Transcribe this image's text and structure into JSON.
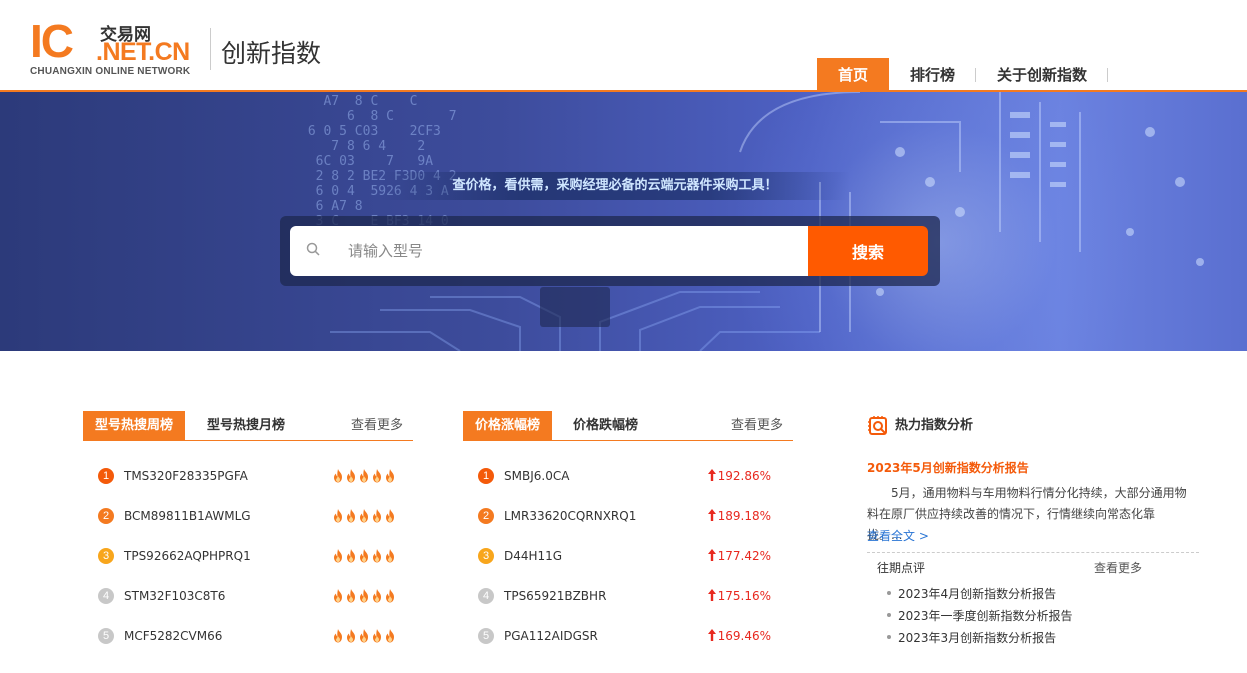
{
  "header": {
    "logo": {
      "ic": "IC",
      "brand_cn": "交易网",
      "net": ".NET.CN",
      "tagline": "CHUANGXIN ONLINE NETWORK"
    },
    "site_title": "创新指数",
    "nav": [
      {
        "label": "首页",
        "active": true
      },
      {
        "label": "排行榜",
        "active": false
      },
      {
        "label": "关于创新指数",
        "active": false
      }
    ]
  },
  "banner": {
    "slogan": "查价格，看供需，采购经理必备的云端元器件采购工具！",
    "search": {
      "placeholder": "请输入型号",
      "value": "",
      "button": "搜索"
    }
  },
  "hot_search": {
    "tab_active": "型号热搜周榜",
    "tab_inactive": "型号热搜月榜",
    "more": "查看更多",
    "items": [
      {
        "rank": "1",
        "name": "TMS320F28335PGFA",
        "flames": 5
      },
      {
        "rank": "2",
        "name": "BCM89811B1AWMLG",
        "flames": 5
      },
      {
        "rank": "3",
        "name": "TPS92662AQPHPRQ1",
        "flames": 5
      },
      {
        "rank": "4",
        "name": "STM32F103C8T6",
        "flames": 5
      },
      {
        "rank": "5",
        "name": "MCF5282CVM66",
        "flames": 5
      }
    ]
  },
  "price_rise": {
    "tab_active": "价格涨幅榜",
    "tab_inactive": "价格跌幅榜",
    "more": "查看更多",
    "items": [
      {
        "rank": "1",
        "name": "SMBJ6.0CA",
        "pct": "192.86%"
      },
      {
        "rank": "2",
        "name": "LMR33620CQRNXRQ1",
        "pct": "189.18%"
      },
      {
        "rank": "3",
        "name": "D44H11G",
        "pct": "177.42%"
      },
      {
        "rank": "4",
        "name": "TPS65921BZBHR",
        "pct": "175.16%"
      },
      {
        "rank": "5",
        "name": "PGA112AIDGSR",
        "pct": "169.46%"
      }
    ]
  },
  "analysis": {
    "title": "热力指数分析",
    "report_title": "2023年5月创新指数分析报告",
    "report_summary": "5月，通用物料与车用物料行情分化持续，大部分通用物料在原厂供应持续改善的情况下，行情继续向常态化靠拢。...",
    "read_more": "查看全文 >",
    "past_title": "往期点评",
    "past_more": "查看更多",
    "past_items": [
      "2023年4月创新指数分析报告",
      "2023年一季度创新指数分析报告",
      "2023年3月创新指数分析报告"
    ]
  },
  "colors": {
    "accent": "#f47a20",
    "search_button": "#ff5a00",
    "rise": "#e8281e",
    "link": "#2a75d4"
  }
}
